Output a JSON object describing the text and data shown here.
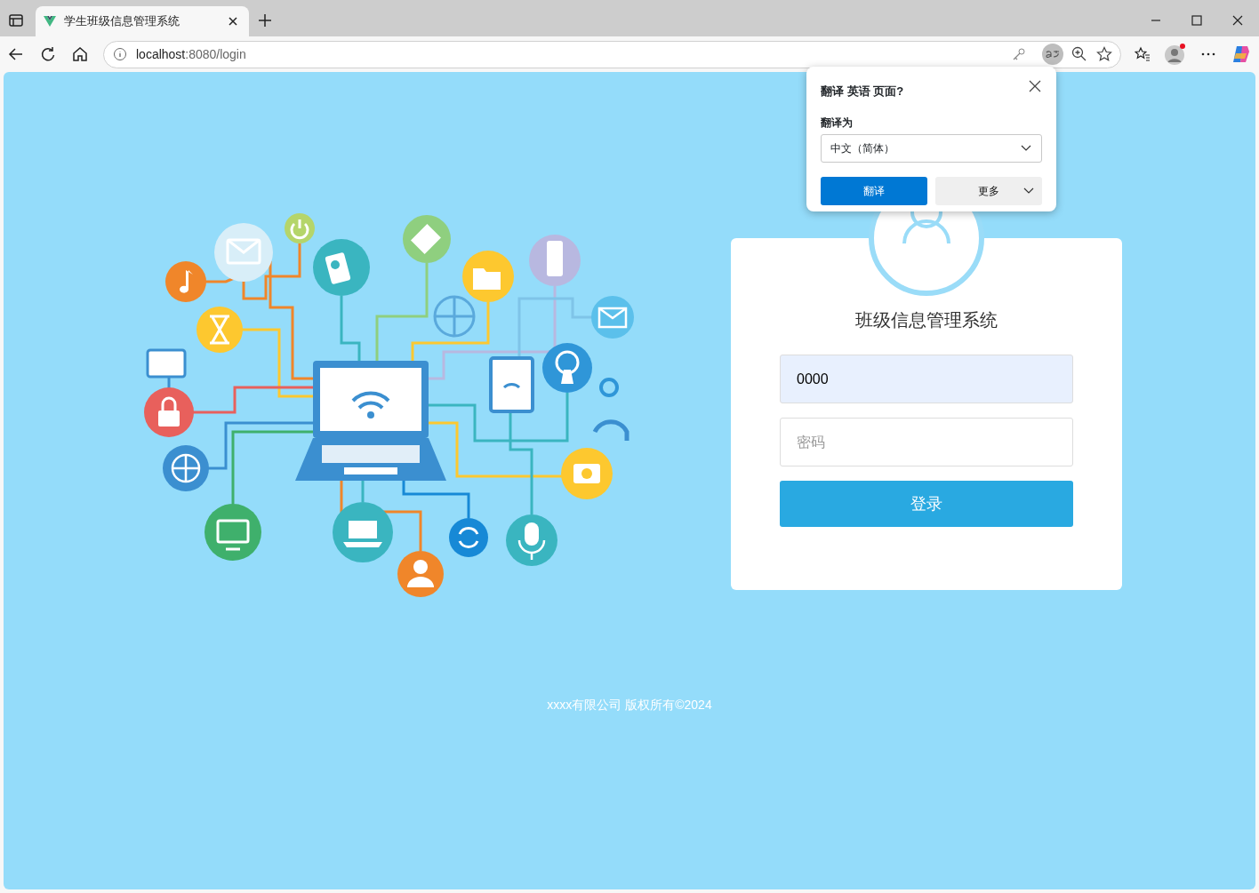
{
  "browser": {
    "tab": {
      "title": "学生班级信息管理系统",
      "selected": true
    },
    "address": {
      "host": "localhost",
      "path": ":8080/login"
    }
  },
  "translate_popup": {
    "title": "翻译 英语 页面?",
    "label": "翻译为",
    "language": "中文（简体）",
    "primary_button": "翻译",
    "secondary_button": "更多"
  },
  "login": {
    "title": "班级信息管理系统",
    "username": {
      "value": "0000"
    },
    "password": {
      "placeholder": "密码"
    },
    "submit": "登录"
  },
  "footer": "xxxx有限公司 版权所有©2024"
}
